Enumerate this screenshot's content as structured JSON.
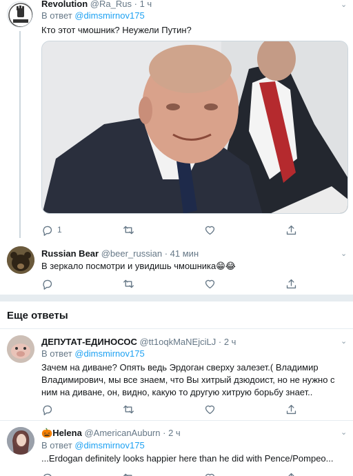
{
  "tweet1": {
    "name": "Revolution",
    "handle": "@Ra_Rus",
    "dot": "·",
    "time": "1 ч",
    "reply_prefix": "В ответ",
    "reply_handle": "@dimsmirnov175",
    "text": "Кто этот чмошник? Неужели Путин?",
    "avatar_text": "REVOLUTION",
    "reply_count": "1"
  },
  "tweet2": {
    "name": "Russian Bear",
    "handle": "@beer_russian",
    "dot": "·",
    "time": "41 мин",
    "text": "В зеркало посмотри и увидишь чмошника😁😂"
  },
  "section": {
    "title": "Еще ответы"
  },
  "tweet3": {
    "name": "ДЕПУТАТ-ЕДИНОСОС",
    "handle": "@tt1oqkMaNEjciLJ",
    "dot": "·",
    "time": "2 ч",
    "reply_prefix": "В ответ",
    "reply_handle": "@dimsmirnov175",
    "text": "Зачем на диване? Опять ведь Эрдоган сверху залезет.( Владимир Владимирович, мы все знаем, что Вы хитрый дзюдоист, но не нужно с ним на диване, он, видно, какую то другую хитрую борьбу знает.."
  },
  "tweet4": {
    "name_prefix": "🎃",
    "name": "Helena",
    "handle": "@AmericanAuburn",
    "dot": "·",
    "time": "2 ч",
    "reply_prefix": "В ответ",
    "reply_handle": "@dimsmirnov175",
    "text": "...Erdogan definitely looks happier here than he did with Pence/Pompeo..."
  },
  "icons": {
    "reply": "reply-icon",
    "retweet": "retweet-icon",
    "like": "heart-icon",
    "share": "share-icon",
    "more": "chevron-down-icon"
  },
  "colors": {
    "link": "#1da1f2",
    "secondary_text": "#657786",
    "divider": "#e6ecf0"
  }
}
